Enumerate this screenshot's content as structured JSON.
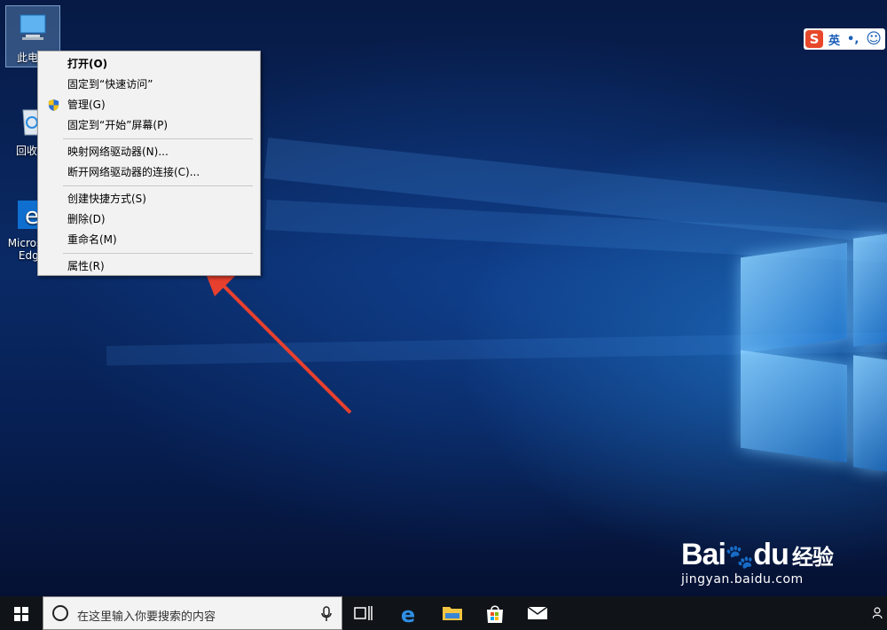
{
  "desktop": {
    "icons": [
      {
        "label": "此电脑",
        "icon": "this-pc-icon"
      },
      {
        "label": "回收站",
        "icon": "recycle-bin-icon"
      },
      {
        "label": "Microsoft Edge",
        "icon": "edge-icon"
      }
    ]
  },
  "context_menu": {
    "items": [
      {
        "label": "打开(O)",
        "bold": true
      },
      {
        "label": "固定到“快速访问”"
      },
      {
        "label": "管理(G)",
        "icon": "uac-shield-icon"
      },
      {
        "label": "固定到“开始”屏幕(P)"
      },
      {
        "label": "映射网络驱动器(N)..."
      },
      {
        "label": "断开网络驱动器的连接(C)..."
      },
      {
        "label": "创建快捷方式(S)"
      },
      {
        "label": "删除(D)"
      },
      {
        "label": "重命名(M)"
      },
      {
        "label": "属性(R)"
      }
    ]
  },
  "ime": {
    "brand": "S",
    "mode": "英",
    "punct": "•,",
    "emoji": "☺"
  },
  "taskbar": {
    "search_placeholder": "在这里输入你要搜索的内容",
    "apps": [
      "task-view-icon",
      "edge-icon",
      "file-explorer-icon",
      "store-icon",
      "mail-icon"
    ]
  },
  "watermark": {
    "logo": "Bai",
    "logo2": "du",
    "logo_cn": "经验",
    "url": "jingyan.baidu.com"
  },
  "colors": {
    "accent": "#0078d7",
    "arrow": "#e8402e",
    "menu_bg": "#f2f2f2"
  }
}
